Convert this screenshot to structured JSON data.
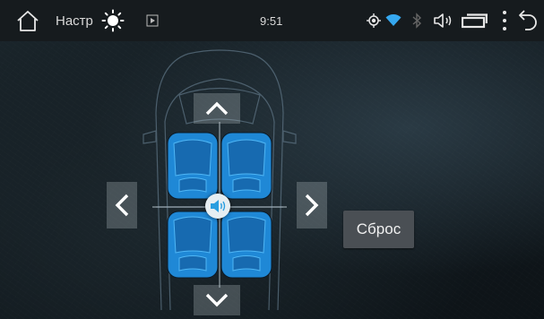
{
  "statusbar": {
    "title": "Настр",
    "time": "9:51"
  },
  "main": {
    "reset_label": "Сброс"
  },
  "icons": {
    "home": "home-icon",
    "brightness": "sun-icon",
    "media": "play-icon",
    "location": "location-icon",
    "wifi": "wifi-icon",
    "bluetooth": "bluetooth-icon",
    "volume": "volume-icon",
    "recent": "recent-apps-icon",
    "menu": "menu-icon",
    "back": "back-icon"
  },
  "colors": {
    "seat_blue": "#1f88d6",
    "accent": "#35a8f0",
    "statusbar_bg": "#161b1e"
  }
}
